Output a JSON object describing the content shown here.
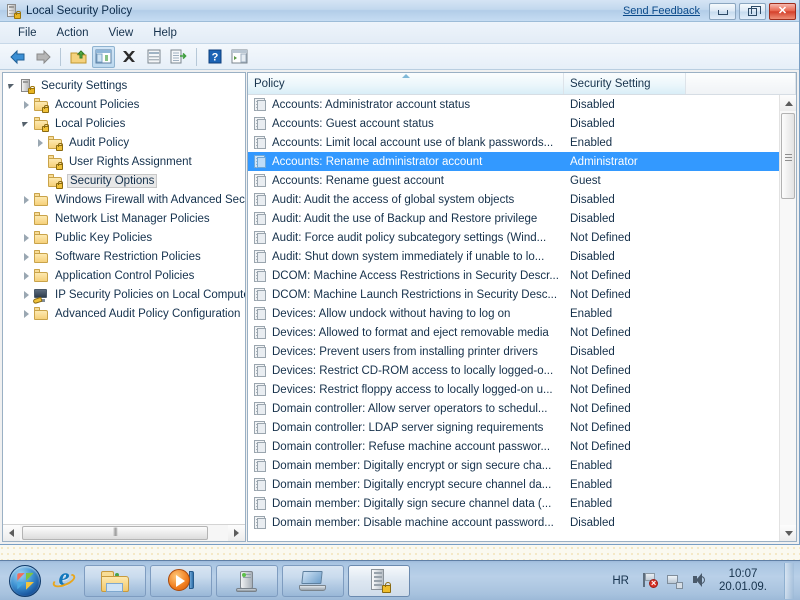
{
  "window": {
    "title": "Local Security Policy",
    "app_icon": "security-policy-icon",
    "send_feedback": "Send Feedback",
    "buttons": {
      "minimize": "Minimize",
      "restore": "Restore",
      "close": "Close"
    }
  },
  "menu": {
    "items": [
      "File",
      "Action",
      "View",
      "Help"
    ]
  },
  "toolbar": {
    "buttons": [
      {
        "name": "back-icon",
        "label": "Back"
      },
      {
        "name": "forward-icon",
        "label": "Forward"
      },
      {
        "name": "up-one-level-icon",
        "label": "Up One Level"
      },
      {
        "name": "show-hide-console-tree-icon",
        "label": "Show/Hide Console Tree"
      },
      {
        "name": "delete-icon",
        "label": "Delete"
      },
      {
        "name": "properties-icon",
        "label": "Properties"
      },
      {
        "name": "export-list-icon",
        "label": "Export List"
      },
      {
        "name": "help-icon",
        "label": "Help"
      },
      {
        "name": "show-action-pane-icon",
        "label": "Show/Hide Action Pane"
      }
    ]
  },
  "tree": {
    "nodes": [
      {
        "label": "Security Settings",
        "indent": 0,
        "expander": "expanded",
        "icon": "security-settings-icon",
        "selected": false
      },
      {
        "label": "Account Policies",
        "indent": 1,
        "expander": "collapsed",
        "icon": "folder-lock-icon",
        "selected": false
      },
      {
        "label": "Local Policies",
        "indent": 1,
        "expander": "expanded",
        "icon": "folder-lock-icon",
        "selected": false
      },
      {
        "label": "Audit Policy",
        "indent": 2,
        "expander": "collapsed",
        "icon": "folder-lock-icon",
        "selected": false
      },
      {
        "label": "User Rights Assignment",
        "indent": 2,
        "expander": "none",
        "icon": "folder-lock-icon",
        "selected": false
      },
      {
        "label": "Security Options",
        "indent": 2,
        "expander": "none",
        "icon": "folder-lock-icon",
        "selected": true
      },
      {
        "label": "Windows Firewall with Advanced Secu",
        "indent": 1,
        "expander": "collapsed",
        "icon": "folder-icon",
        "selected": false
      },
      {
        "label": "Network List Manager Policies",
        "indent": 1,
        "expander": "none",
        "icon": "folder-icon",
        "selected": false
      },
      {
        "label": "Public Key Policies",
        "indent": 1,
        "expander": "collapsed",
        "icon": "folder-icon",
        "selected": false
      },
      {
        "label": "Software Restriction Policies",
        "indent": 1,
        "expander": "collapsed",
        "icon": "folder-icon",
        "selected": false
      },
      {
        "label": "Application Control Policies",
        "indent": 1,
        "expander": "collapsed",
        "icon": "folder-icon",
        "selected": false
      },
      {
        "label": "IP Security Policies on Local Compute",
        "indent": 1,
        "expander": "collapsed",
        "icon": "ipsec-icon",
        "selected": false
      },
      {
        "label": "Advanced Audit Policy Configuration",
        "indent": 1,
        "expander": "collapsed",
        "icon": "folder-icon",
        "selected": false
      }
    ]
  },
  "list": {
    "columns": [
      "Policy",
      "Security Setting",
      ""
    ],
    "sorted_column": "Policy",
    "rows": [
      {
        "policy": "Accounts: Administrator account status",
        "setting": "Disabled",
        "selected": false
      },
      {
        "policy": "Accounts: Guest account status",
        "setting": "Disabled",
        "selected": false
      },
      {
        "policy": "Accounts: Limit local account use of blank passwords...",
        "setting": "Enabled",
        "selected": false
      },
      {
        "policy": "Accounts: Rename administrator account",
        "setting": "Administrator",
        "selected": true
      },
      {
        "policy": "Accounts: Rename guest account",
        "setting": "Guest",
        "selected": false
      },
      {
        "policy": "Audit: Audit the access of global system objects",
        "setting": "Disabled",
        "selected": false
      },
      {
        "policy": "Audit: Audit the use of Backup and Restore privilege",
        "setting": "Disabled",
        "selected": false
      },
      {
        "policy": "Audit: Force audit policy subcategory settings (Wind...",
        "setting": "Not Defined",
        "selected": false
      },
      {
        "policy": "Audit: Shut down system immediately if unable to lo...",
        "setting": "Disabled",
        "selected": false
      },
      {
        "policy": "DCOM: Machine Access Restrictions in Security Descr...",
        "setting": "Not Defined",
        "selected": false
      },
      {
        "policy": "DCOM: Machine Launch Restrictions in Security Desc...",
        "setting": "Not Defined",
        "selected": false
      },
      {
        "policy": "Devices: Allow undock without having to log on",
        "setting": "Enabled",
        "selected": false
      },
      {
        "policy": "Devices: Allowed to format and eject removable media",
        "setting": "Not Defined",
        "selected": false
      },
      {
        "policy": "Devices: Prevent users from installing printer drivers",
        "setting": "Disabled",
        "selected": false
      },
      {
        "policy": "Devices: Restrict CD-ROM access to locally logged-o...",
        "setting": "Not Defined",
        "selected": false
      },
      {
        "policy": "Devices: Restrict floppy access to locally logged-on u...",
        "setting": "Not Defined",
        "selected": false
      },
      {
        "policy": "Domain controller: Allow server operators to schedul...",
        "setting": "Not Defined",
        "selected": false
      },
      {
        "policy": "Domain controller: LDAP server signing requirements",
        "setting": "Not Defined",
        "selected": false
      },
      {
        "policy": "Domain controller: Refuse machine account passwor...",
        "setting": "Not Defined",
        "selected": false
      },
      {
        "policy": "Domain member: Digitally encrypt or sign secure cha...",
        "setting": "Enabled",
        "selected": false
      },
      {
        "policy": "Domain member: Digitally encrypt secure channel da...",
        "setting": "Enabled",
        "selected": false
      },
      {
        "policy": "Domain member: Digitally sign secure channel data (...",
        "setting": "Enabled",
        "selected": false
      },
      {
        "policy": "Domain member: Disable machine account password...",
        "setting": "Disabled",
        "selected": false
      }
    ]
  },
  "taskbar": {
    "start_label": "Start",
    "quick_launch": [
      {
        "name": "internet-explorer-icon",
        "label": "Internet Explorer"
      }
    ],
    "tasks": [
      {
        "name": "windows-explorer-task",
        "label": "Windows Explorer",
        "icon": "folder-icon",
        "active": false
      },
      {
        "name": "windows-media-player-task",
        "label": "Windows Media Player",
        "icon": "media-player-icon",
        "active": false
      },
      {
        "name": "computer-task",
        "label": "Computer",
        "icon": "computer-icon",
        "active": false
      },
      {
        "name": "laptop-task",
        "label": "Laptop",
        "icon": "laptop-icon",
        "active": false
      },
      {
        "name": "local-security-policy-task",
        "label": "Local Security Policy",
        "icon": "security-policy-icon",
        "active": true
      }
    ],
    "tray": {
      "language": "HR",
      "icons": [
        {
          "name": "action-center-flag-icon",
          "label": "Action Center"
        },
        {
          "name": "network-icon",
          "label": "Network"
        },
        {
          "name": "volume-icon",
          "label": "Volume"
        }
      ],
      "clock_time": "10:07",
      "clock_date": "20.01.09."
    }
  },
  "colors": {
    "selection": "#3399ff",
    "titlebar": "#c2d8ee",
    "taskbar": "#b9d0e8",
    "desktop": "#faf9f0"
  }
}
